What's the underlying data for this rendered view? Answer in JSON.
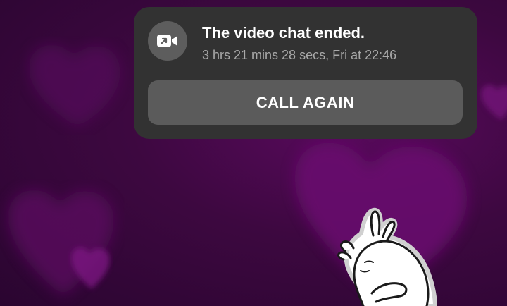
{
  "notification": {
    "icon": "video-call-icon",
    "title": "The video chat ended.",
    "details": "3 hrs 21 mins 28 secs, Fri at 22:46",
    "action_label": "CALL AGAIN"
  },
  "colors": {
    "card_background": "#323232",
    "button_background": "#5b5b5b",
    "icon_background": "#5d5d5d",
    "background_purple": "#3d0840"
  },
  "sticker": {
    "icon": "bunny-sticker"
  }
}
